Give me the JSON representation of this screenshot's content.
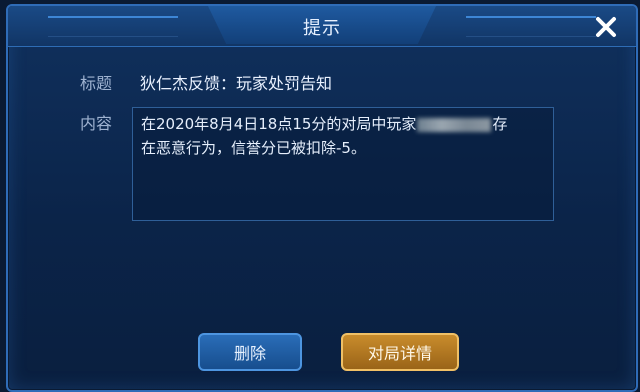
{
  "dialog": {
    "title": "提示",
    "close_icon": "close-icon"
  },
  "message": {
    "subject_label": "标题",
    "subject_value": "狄仁杰反馈：玩家处罚告知",
    "content_label": "内容",
    "content_line1_before": "在2020年8月4日18点15分的对局中玩家",
    "content_line1_after": "存",
    "content_line2": "在恶意行为，信誉分已被扣除-5。"
  },
  "buttons": {
    "delete_label": "删除",
    "detail_label": "对局详情"
  },
  "colors": {
    "dialog_bg": "#0b2449",
    "frame_border": "#2f6cb8",
    "delete_button": "#1f5ea3",
    "detail_button": "#b47a22"
  }
}
